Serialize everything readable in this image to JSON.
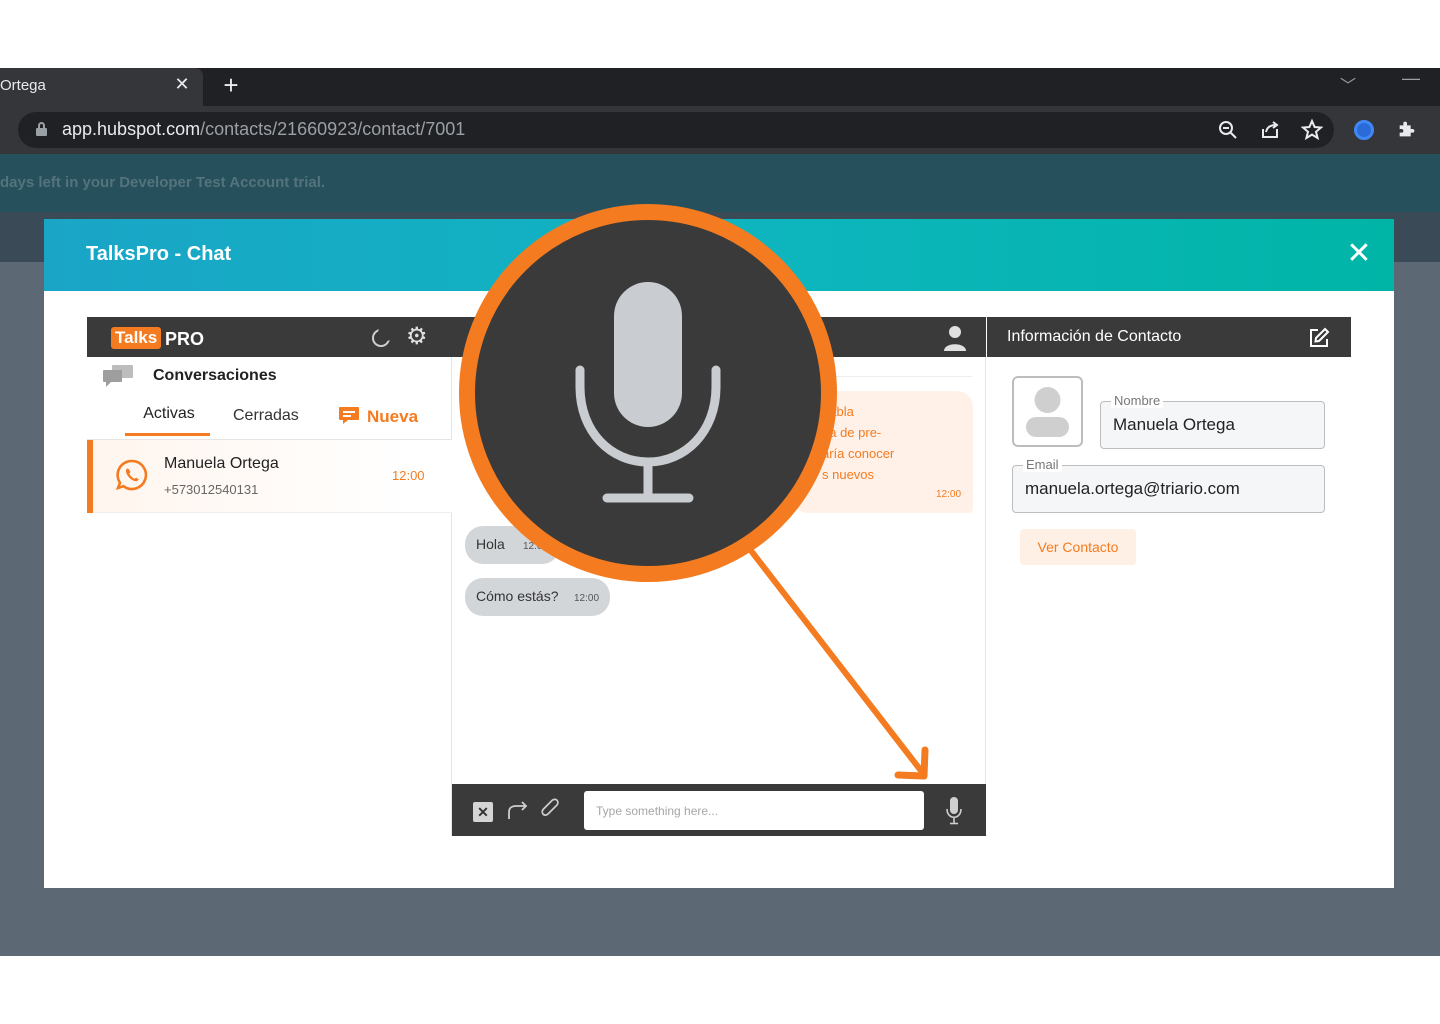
{
  "browser": {
    "tab_title": "Ortega",
    "tab_close": "✕",
    "new_tab": "+",
    "url_host": "app.hubspot.com",
    "url_path": "/contacts/21660923/contact/7001"
  },
  "page": {
    "trial_banner": "days left in your Developer Test Account trial."
  },
  "modal": {
    "title": "TalksPro - Chat",
    "close": "✕"
  },
  "left": {
    "brand_talks": "Talks",
    "brand_pro": "PRO",
    "conversations_title": "Conversaciones",
    "tabs": {
      "active": "Activas",
      "closed": "Cerradas",
      "new": "Nueva"
    },
    "conversation": {
      "name": "Manuela Ortega",
      "phone": "+573012540131",
      "time": "12:00"
    }
  },
  "chat": {
    "outgoing": {
      "text": "habla\nea de pre-\naría conocer\ns nuevos",
      "time": "12:00"
    },
    "incoming": [
      {
        "text": "Hola",
        "time": "12:00"
      },
      {
        "text": "Cómo estás?",
        "time": "12:00"
      }
    ],
    "composer_placeholder": "Type something here..."
  },
  "contact": {
    "header": "Información de Contacto",
    "name_label": "Nombre",
    "name_value": "Manuela Ortega",
    "email_label": "Email",
    "email_value": "manuela.ortega@triario.com",
    "view_button": "Ver Contacto"
  },
  "colors": {
    "accent": "#f47b20",
    "panel_header": "#3a3a3a",
    "modal_gradient_start": "#1aa5c7",
    "modal_gradient_end": "#00b5a6"
  }
}
